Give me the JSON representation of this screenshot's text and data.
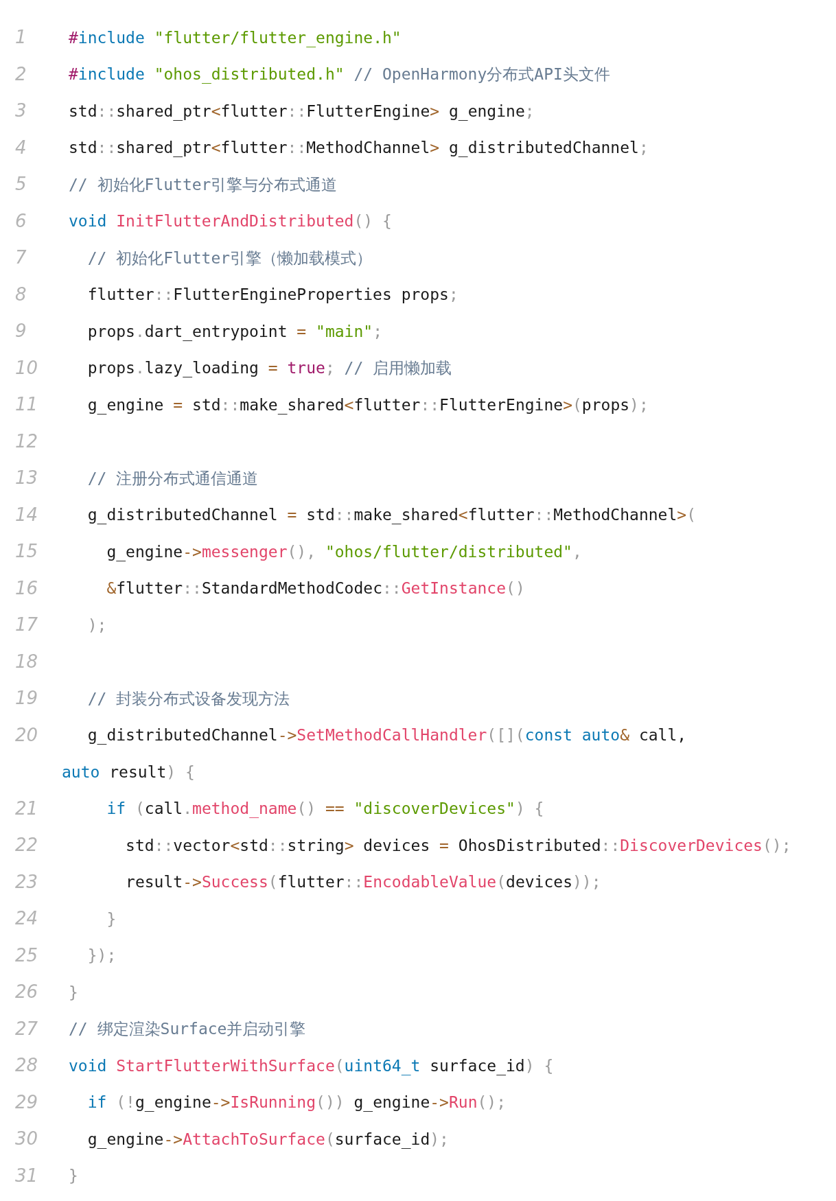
{
  "lines": [
    {
      "number": "1",
      "tokens": [
        {
          "kind": "macro",
          "text": "#"
        },
        {
          "kind": "keyword",
          "text": "include "
        },
        {
          "kind": "string",
          "text": "\"flutter/flutter_engine.h\""
        }
      ]
    },
    {
      "number": "2",
      "tokens": [
        {
          "kind": "macro",
          "text": "#"
        },
        {
          "kind": "keyword",
          "text": "include "
        },
        {
          "kind": "string",
          "text": "\"ohos_distributed.h\""
        },
        {
          "kind": "comment",
          "text": " // OpenHarmony分布式API头文件"
        }
      ]
    },
    {
      "number": "3",
      "tokens": [
        {
          "kind": "plain",
          "text": "std"
        },
        {
          "kind": "punct",
          "text": "::"
        },
        {
          "kind": "plain",
          "text": "shared_ptr"
        },
        {
          "kind": "operator",
          "text": "<"
        },
        {
          "kind": "plain",
          "text": "flutter"
        },
        {
          "kind": "punct",
          "text": "::"
        },
        {
          "kind": "plain",
          "text": "FlutterEngine"
        },
        {
          "kind": "operator",
          "text": ">"
        },
        {
          "kind": "plain",
          "text": " g_engine"
        },
        {
          "kind": "punct",
          "text": ";"
        }
      ]
    },
    {
      "number": "4",
      "tokens": [
        {
          "kind": "plain",
          "text": "std"
        },
        {
          "kind": "punct",
          "text": "::"
        },
        {
          "kind": "plain",
          "text": "shared_ptr"
        },
        {
          "kind": "operator",
          "text": "<"
        },
        {
          "kind": "plain",
          "text": "flutter"
        },
        {
          "kind": "punct",
          "text": "::"
        },
        {
          "kind": "plain",
          "text": "MethodChannel"
        },
        {
          "kind": "operator",
          "text": ">"
        },
        {
          "kind": "plain",
          "text": " g_distributedChannel"
        },
        {
          "kind": "punct",
          "text": ";"
        }
      ]
    },
    {
      "number": "5",
      "tokens": [
        {
          "kind": "comment",
          "text": "// 初始化Flutter引擎与分布式通道"
        }
      ]
    },
    {
      "number": "6",
      "tokens": [
        {
          "kind": "keyword",
          "text": "void "
        },
        {
          "kind": "function",
          "text": "InitFlutterAndDistributed"
        },
        {
          "kind": "punct",
          "text": "() {"
        }
      ]
    },
    {
      "number": "7",
      "tokens": [
        {
          "kind": "comment",
          "text": "  // 初始化Flutter引擎（懒加载模式）"
        }
      ]
    },
    {
      "number": "8",
      "tokens": [
        {
          "kind": "plain",
          "text": "  flutter"
        },
        {
          "kind": "punct",
          "text": "::"
        },
        {
          "kind": "plain",
          "text": "FlutterEngineProperties props"
        },
        {
          "kind": "punct",
          "text": ";"
        }
      ]
    },
    {
      "number": "9",
      "tokens": [
        {
          "kind": "plain",
          "text": "  props"
        },
        {
          "kind": "punct",
          "text": "."
        },
        {
          "kind": "plain",
          "text": "dart_entrypoint "
        },
        {
          "kind": "operator",
          "text": "= "
        },
        {
          "kind": "string",
          "text": "\"main\""
        },
        {
          "kind": "punct",
          "text": ";"
        }
      ]
    },
    {
      "number": "10",
      "tokens": [
        {
          "kind": "plain",
          "text": "  props"
        },
        {
          "kind": "punct",
          "text": "."
        },
        {
          "kind": "plain",
          "text": "lazy_loading "
        },
        {
          "kind": "operator",
          "text": "= "
        },
        {
          "kind": "macro",
          "text": "true"
        },
        {
          "kind": "punct",
          "text": "; "
        },
        {
          "kind": "comment",
          "text": "// 启用懒加载"
        }
      ]
    },
    {
      "number": "11",
      "tokens": [
        {
          "kind": "plain",
          "text": "  g_engine "
        },
        {
          "kind": "operator",
          "text": "= "
        },
        {
          "kind": "plain",
          "text": "std"
        },
        {
          "kind": "punct",
          "text": "::"
        },
        {
          "kind": "plain",
          "text": "make_shared"
        },
        {
          "kind": "operator",
          "text": "<"
        },
        {
          "kind": "plain",
          "text": "flutter"
        },
        {
          "kind": "punct",
          "text": "::"
        },
        {
          "kind": "plain",
          "text": "FlutterEngine"
        },
        {
          "kind": "operator",
          "text": ">"
        },
        {
          "kind": "punct",
          "text": "("
        },
        {
          "kind": "plain",
          "text": "props"
        },
        {
          "kind": "punct",
          "text": ");"
        }
      ]
    },
    {
      "number": "12"
    },
    {
      "number": "13",
      "tokens": [
        {
          "kind": "comment",
          "text": "  // 注册分布式通信通道"
        }
      ]
    },
    {
      "number": "14",
      "tokens": [
        {
          "kind": "plain",
          "text": "  g_distributedChannel "
        },
        {
          "kind": "operator",
          "text": "= "
        },
        {
          "kind": "plain",
          "text": "std"
        },
        {
          "kind": "punct",
          "text": "::"
        },
        {
          "kind": "plain",
          "text": "make_shared"
        },
        {
          "kind": "operator",
          "text": "<"
        },
        {
          "kind": "plain",
          "text": "flutter"
        },
        {
          "kind": "punct",
          "text": "::"
        },
        {
          "kind": "plain",
          "text": "MethodChannel"
        },
        {
          "kind": "operator",
          "text": ">"
        },
        {
          "kind": "punct",
          "text": "("
        }
      ]
    },
    {
      "number": "15",
      "tokens": [
        {
          "kind": "plain",
          "text": "    g_engine"
        },
        {
          "kind": "operator",
          "text": "->"
        },
        {
          "kind": "function",
          "text": "messenger"
        },
        {
          "kind": "punct",
          "text": "(), "
        },
        {
          "kind": "string",
          "text": "\"ohos/flutter/distributed\""
        },
        {
          "kind": "punct",
          "text": ","
        }
      ]
    },
    {
      "number": "16",
      "tokens": [
        {
          "kind": "operator",
          "text": "    &"
        },
        {
          "kind": "plain",
          "text": "flutter"
        },
        {
          "kind": "punct",
          "text": "::"
        },
        {
          "kind": "plain",
          "text": "StandardMethodCodec"
        },
        {
          "kind": "punct",
          "text": "::"
        },
        {
          "kind": "function",
          "text": "GetInstance"
        },
        {
          "kind": "punct",
          "text": "()"
        }
      ]
    },
    {
      "number": "17",
      "tokens": [
        {
          "kind": "punct",
          "text": "  );"
        }
      ]
    },
    {
      "number": "18"
    },
    {
      "number": "19",
      "tokens": [
        {
          "kind": "comment",
          "text": "  // 封装分布式设备发现方法"
        }
      ]
    },
    {
      "number": "20",
      "tokens": [
        {
          "kind": "plain",
          "text": "  g_distributedChannel"
        },
        {
          "kind": "operator",
          "text": "->"
        },
        {
          "kind": "function",
          "text": "SetMethodCallHandler"
        },
        {
          "kind": "punct",
          "text": "([]("
        },
        {
          "kind": "keyword",
          "text": "const auto"
        },
        {
          "kind": "operator",
          "text": "& "
        },
        {
          "kind": "plain",
          "text": "call,"
        }
      ],
      "continuation": [
        {
          "kind": "keyword",
          "text": "auto "
        },
        {
          "kind": "plain",
          "text": "result"
        },
        {
          "kind": "punct",
          "text": ") {"
        }
      ]
    },
    {
      "number": "21",
      "tokens": [
        {
          "kind": "keyword",
          "text": "    if "
        },
        {
          "kind": "punct",
          "text": "("
        },
        {
          "kind": "plain",
          "text": "call"
        },
        {
          "kind": "punct",
          "text": "."
        },
        {
          "kind": "function",
          "text": "method_name"
        },
        {
          "kind": "punct",
          "text": "() "
        },
        {
          "kind": "operator",
          "text": "== "
        },
        {
          "kind": "string",
          "text": "\"discoverDevices\""
        },
        {
          "kind": "punct",
          "text": ") {"
        }
      ]
    },
    {
      "number": "22",
      "tokens": [
        {
          "kind": "plain",
          "text": "      std"
        },
        {
          "kind": "punct",
          "text": "::"
        },
        {
          "kind": "plain",
          "text": "vector"
        },
        {
          "kind": "operator",
          "text": "<"
        },
        {
          "kind": "plain",
          "text": "std"
        },
        {
          "kind": "punct",
          "text": "::"
        },
        {
          "kind": "plain",
          "text": "string"
        },
        {
          "kind": "operator",
          "text": ">"
        },
        {
          "kind": "plain",
          "text": " devices "
        },
        {
          "kind": "operator",
          "text": "= "
        },
        {
          "kind": "plain",
          "text": "OhosDistributed"
        },
        {
          "kind": "punct",
          "text": "::"
        },
        {
          "kind": "function",
          "text": "DiscoverDevices"
        },
        {
          "kind": "punct",
          "text": "();"
        }
      ]
    },
    {
      "number": "23",
      "tokens": [
        {
          "kind": "plain",
          "text": "      result"
        },
        {
          "kind": "operator",
          "text": "->"
        },
        {
          "kind": "function",
          "text": "Success"
        },
        {
          "kind": "punct",
          "text": "("
        },
        {
          "kind": "plain",
          "text": "flutter"
        },
        {
          "kind": "punct",
          "text": "::"
        },
        {
          "kind": "function",
          "text": "EncodableValue"
        },
        {
          "kind": "punct",
          "text": "("
        },
        {
          "kind": "plain",
          "text": "devices"
        },
        {
          "kind": "punct",
          "text": "));"
        }
      ]
    },
    {
      "number": "24",
      "tokens": [
        {
          "kind": "punct",
          "text": "    }"
        }
      ]
    },
    {
      "number": "25",
      "tokens": [
        {
          "kind": "punct",
          "text": "  });"
        }
      ]
    },
    {
      "number": "26",
      "tokens": [
        {
          "kind": "punct",
          "text": "}"
        }
      ]
    },
    {
      "number": "27",
      "tokens": [
        {
          "kind": "comment",
          "text": "// 绑定渲染Surface并启动引擎"
        }
      ]
    },
    {
      "number": "28",
      "tokens": [
        {
          "kind": "keyword",
          "text": "void "
        },
        {
          "kind": "function",
          "text": "StartFlutterWithSurface"
        },
        {
          "kind": "punct",
          "text": "("
        },
        {
          "kind": "keyword",
          "text": "uint64_t "
        },
        {
          "kind": "plain",
          "text": "surface_id"
        },
        {
          "kind": "punct",
          "text": ") {"
        }
      ]
    },
    {
      "number": "29",
      "tokens": [
        {
          "kind": "keyword",
          "text": "  if "
        },
        {
          "kind": "punct",
          "text": "(!"
        },
        {
          "kind": "plain",
          "text": "g_engine"
        },
        {
          "kind": "operator",
          "text": "->"
        },
        {
          "kind": "function",
          "text": "IsRunning"
        },
        {
          "kind": "punct",
          "text": "()) "
        },
        {
          "kind": "plain",
          "text": "g_engine"
        },
        {
          "kind": "operator",
          "text": "->"
        },
        {
          "kind": "function",
          "text": "Run"
        },
        {
          "kind": "punct",
          "text": "();"
        }
      ]
    },
    {
      "number": "30",
      "tokens": [
        {
          "kind": "plain",
          "text": "  g_engine"
        },
        {
          "kind": "operator",
          "text": "->"
        },
        {
          "kind": "function",
          "text": "AttachToSurface"
        },
        {
          "kind": "punct",
          "text": "("
        },
        {
          "kind": "plain",
          "text": "surface_id"
        },
        {
          "kind": "punct",
          "text": ");"
        }
      ]
    },
    {
      "number": "31",
      "tokens": [
        {
          "kind": "punct",
          "text": "}"
        }
      ]
    }
  ]
}
